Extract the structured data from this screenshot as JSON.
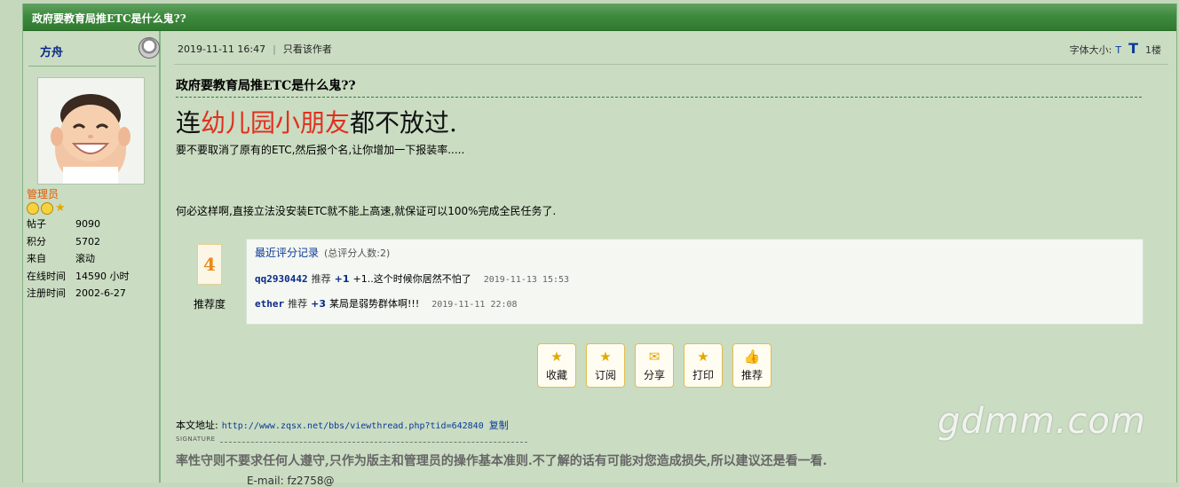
{
  "thread_title": "政府要教育局推ETC是什么鬼??",
  "author": {
    "name": "方舟",
    "role": "管理员",
    "stats": [
      {
        "key": "帖子",
        "value": "9090"
      },
      {
        "key": "积分",
        "value": "5702"
      },
      {
        "key": "来自",
        "value": "滚动"
      },
      {
        "key": "在线时间",
        "value": "14590 小时"
      },
      {
        "key": "注册时间",
        "value": "2002-6-27"
      }
    ]
  },
  "post": {
    "datetime": "2019-11-11 16:47",
    "only_author": "只看该作者",
    "font_size_label": "字体大小:",
    "font_small": "T",
    "font_large": "T",
    "floor": "1楼",
    "title": "政府要教育局推ETC是什么鬼??",
    "big_prefix": "连",
    "big_red": "幼儿园小朋友",
    "big_suffix": "都不放过.",
    "line1": "要不要取消了原有的ETC,然后报个名,让你增加一下报装率.....",
    "line2": "何必这样啊,直接立法没安装ETC就不能上高速,就保证可以100%完成全民任务了."
  },
  "rating": {
    "score": "4",
    "score_label": "推荐度",
    "header": "最近评分记录",
    "count_text": "(总评分人数:2)",
    "records": [
      {
        "user": "qq2930442",
        "tag": "推荐",
        "points": "+1",
        "comment": "+1..这个时候你居然不怕了",
        "time": "2019-11-13 15:53"
      },
      {
        "user": "ether",
        "tag": "推荐",
        "points": "+3",
        "comment": "某局是弱势群体啊!!!",
        "time": "2019-11-11 22:08"
      }
    ]
  },
  "actions": [
    {
      "label": "收藏",
      "icon": "star-icon"
    },
    {
      "label": "订阅",
      "icon": "star-icon"
    },
    {
      "label": "分享",
      "icon": "mail-icon"
    },
    {
      "label": "打印",
      "icon": "star-icon"
    },
    {
      "label": "推荐",
      "icon": "thumbs-up-icon"
    }
  ],
  "url_section": {
    "label": "本文地址:",
    "link": "http://www.zqsx.net/bbs/viewthread.php?tid=642840",
    "copy": "复制"
  },
  "signature": {
    "label": "SIGNATURE",
    "text": "率性守则不要求任何人遵守,只作为版主和管理员的操作基本准则.不了解的话有可能对您造成损失,所以建议还是看一看.",
    "line2": "E-mail: fz2758@"
  },
  "watermark": "gdmm.com",
  "colors": {
    "header_green": "#3e8a3e",
    "background": "#c5d8bc",
    "highlight_red": "#e0301e",
    "role_orange": "#e05a00",
    "link_blue": "#0a3a9a"
  }
}
